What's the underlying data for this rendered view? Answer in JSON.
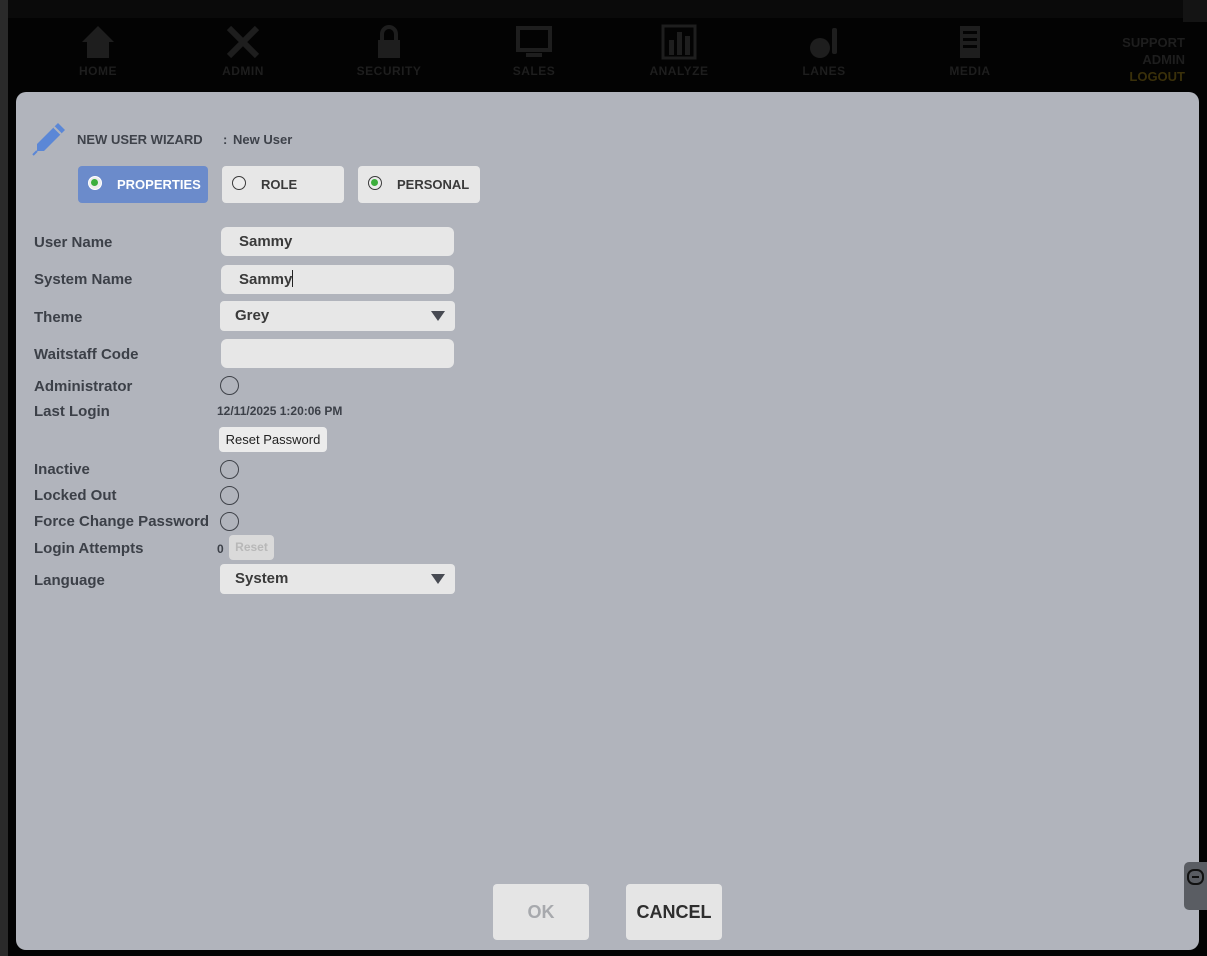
{
  "nav": {
    "items": [
      {
        "label": "HOME",
        "icon": "home-icon"
      },
      {
        "label": "ADMIN",
        "icon": "tools-icon"
      },
      {
        "label": "SECURITY",
        "icon": "lock-icon"
      },
      {
        "label": "SALES",
        "icon": "monitor-icon"
      },
      {
        "label": "ANALYZE",
        "icon": "bar-chart-icon"
      },
      {
        "label": "LANES",
        "icon": "bowling-icon"
      },
      {
        "label": "MEDIA",
        "icon": "media-icon"
      }
    ],
    "user": {
      "line1": "SUPPORT",
      "line2": "ADMIN",
      "logout": "LOGOUT"
    }
  },
  "wizard": {
    "icon": "pencil-icon",
    "title": "NEW USER WIZARD",
    "separator": ":",
    "subtitle": "New User"
  },
  "tabs": [
    {
      "label": "PROPERTIES",
      "active": true,
      "radio_on": true
    },
    {
      "label": "ROLE",
      "active": false,
      "radio_on": false
    },
    {
      "label": "PERSONAL",
      "active": false,
      "radio_on": true
    }
  ],
  "form": {
    "user_name": {
      "label": "User Name",
      "value": "Sammy"
    },
    "system_name": {
      "label": "System Name",
      "value": "Sammy"
    },
    "theme": {
      "label": "Theme",
      "value": "Grey"
    },
    "waitstaff_code": {
      "label": "Waitstaff Code",
      "value": ""
    },
    "administrator": {
      "label": "Administrator",
      "checked": false
    },
    "last_login": {
      "label": "Last Login",
      "value": "12/11/2025 1:20:06 PM"
    },
    "reset_password": {
      "label": "Reset Password"
    },
    "inactive": {
      "label": "Inactive",
      "checked": false
    },
    "locked_out": {
      "label": "Locked Out",
      "checked": false
    },
    "force_change_password": {
      "label": "Force Change Password",
      "checked": false
    },
    "login_attempts": {
      "label": "Login Attempts",
      "value": "0",
      "reset_label": "Reset"
    },
    "language": {
      "label": "Language",
      "value": "System"
    }
  },
  "footer": {
    "ok": "OK",
    "cancel": "CANCEL"
  },
  "colors": {
    "modal_bg": "#b1b4bc",
    "active_tab": "#6b8bcb",
    "radio_green": "#3cae3c",
    "pencil_blue": "#5b87d6"
  }
}
